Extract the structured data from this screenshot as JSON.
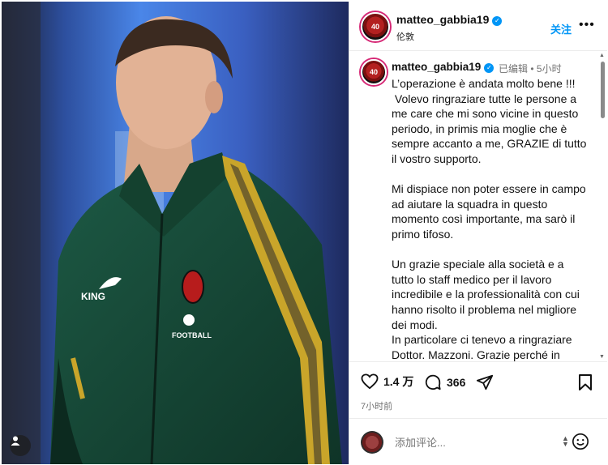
{
  "post": {
    "username": "matteo_gabbia19",
    "location": "伦敦",
    "follow_label": "关注",
    "more_label": "•••",
    "avatar_text": "40",
    "caption": {
      "username": "matteo_gabbia19",
      "edited_label": "已编辑",
      "separator": "•",
      "time_ago": "5小时",
      "text": "L’operazione è andata molto bene !!!\n Volevo ringraziare tutte le persone a me care che mi sono vicine in questo periodo, in primis mia moglie che è sempre accanto a me, GRAZIE di tutto il vostro supporto.\n\nMi dispiace non poter essere in campo ad aiutare la squadra in questo momento così importante, ma sarò il primo tifoso.\n\nUn grazie speciale alla società e a tutto lo staff medico per il lavoro incredibile e la professionalità con cui hanno risolto il problema nel migliore dei modi.\nIn particolare ci tenevo a ringraziare Dottor. Mazzoni. Grazie perché in questi due giorni sei stato un secondo Papà e questa cosa non la"
    },
    "likes": "1.4 万",
    "comments": "366",
    "posted_time": "7小时前",
    "comment_placeholder": "添加评论..."
  },
  "photo": {
    "jersey_brand": "KING",
    "sponsor": "FOOTBALL"
  },
  "icons": {
    "verified": "verified-badge-icon",
    "like": "heart-icon",
    "comment": "comment-bubble-icon",
    "share": "paper-plane-icon",
    "save": "bookmark-icon",
    "emoji": "smiley-icon",
    "user_tag": "person-icon"
  },
  "colors": {
    "accent": "#0095f6",
    "muted": "#737373",
    "jersey": "#1f4a3a",
    "stripe": "#c9a52a"
  }
}
